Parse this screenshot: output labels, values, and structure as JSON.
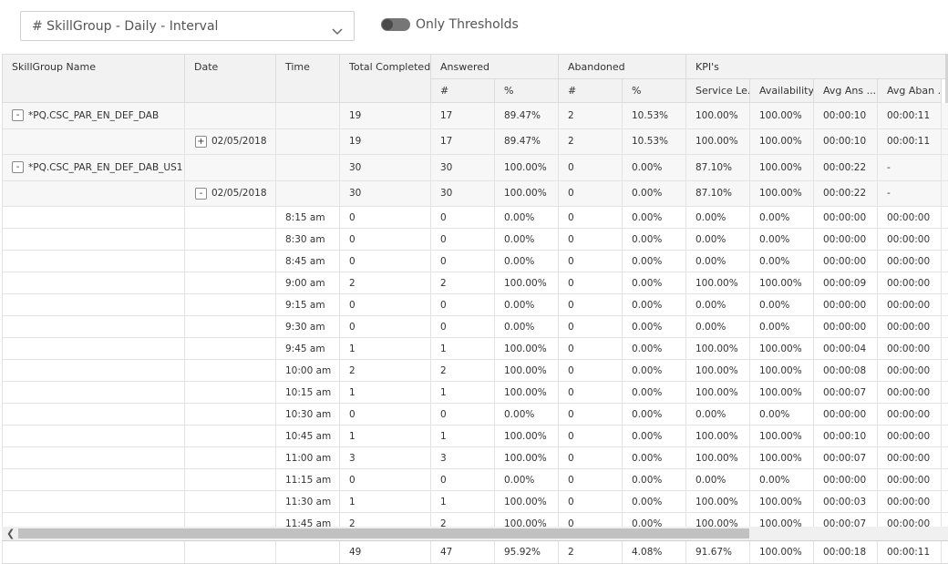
{
  "report_selector": {
    "value": "# SkillGroup - Daily - Interval",
    "icon": "chevron-down-icon"
  },
  "threshold_toggle": {
    "label": "Only Thresholds",
    "on": false
  },
  "table": {
    "headers": {
      "skillgroup": "SkillGroup Name",
      "date": "Date",
      "time": "Time",
      "total_completed": "Total Completed",
      "answered": "Answered",
      "abandoned": "Abandoned",
      "kpis": "KPI's",
      "answered_num": "#",
      "answered_pct": "%",
      "abandoned_num": "#",
      "abandoned_pct": "%",
      "service_level": "Service Le...",
      "availability": "Availability",
      "avg_ans": "Avg Ans ...",
      "avg_aban": "Avg Aban ..."
    },
    "rows": [
      {
        "type": "group",
        "toggle": "-",
        "name": "*PQ.CSC_PAR_EN_DEF_DAB",
        "date": "",
        "time": "",
        "total": "19",
        "ans": "17",
        "ans_pct": "89.47%",
        "aban": "2",
        "aban_pct": "10.53%",
        "sl": "100.00%",
        "avail": "100.00%",
        "avg_ans": "00:00:10",
        "avg_aban": "00:00:11"
      },
      {
        "type": "date",
        "toggle": "+",
        "name": "",
        "date": "02/05/2018",
        "time": "",
        "total": "19",
        "ans": "17",
        "ans_pct": "89.47%",
        "aban": "2",
        "aban_pct": "10.53%",
        "sl": "100.00%",
        "avail": "100.00%",
        "avg_ans": "00:00:10",
        "avg_aban": "00:00:11"
      },
      {
        "type": "group",
        "toggle": "-",
        "name": "*PQ.CSC_PAR_EN_DEF_DAB_US1",
        "date": "",
        "time": "",
        "total": "30",
        "ans": "30",
        "ans_pct": "100.00%",
        "aban": "0",
        "aban_pct": "0.00%",
        "sl": "87.10%",
        "avail": "100.00%",
        "avg_ans": "00:00:22",
        "avg_aban": "-"
      },
      {
        "type": "date",
        "toggle": "-",
        "name": "",
        "date": "02/05/2018",
        "time": "",
        "total": "30",
        "ans": "30",
        "ans_pct": "100.00%",
        "aban": "0",
        "aban_pct": "0.00%",
        "sl": "87.10%",
        "avail": "100.00%",
        "avg_ans": "00:00:22",
        "avg_aban": "-"
      },
      {
        "type": "interval",
        "toggle": "",
        "name": "",
        "date": "",
        "time": "8:15 am",
        "total": "0",
        "ans": "0",
        "ans_pct": "0.00%",
        "aban": "0",
        "aban_pct": "0.00%",
        "sl": "0.00%",
        "avail": "0.00%",
        "avg_ans": "00:00:00",
        "avg_aban": "00:00:00"
      },
      {
        "type": "interval",
        "toggle": "",
        "name": "",
        "date": "",
        "time": "8:30 am",
        "total": "0",
        "ans": "0",
        "ans_pct": "0.00%",
        "aban": "0",
        "aban_pct": "0.00%",
        "sl": "0.00%",
        "avail": "0.00%",
        "avg_ans": "00:00:00",
        "avg_aban": "00:00:00"
      },
      {
        "type": "interval",
        "toggle": "",
        "name": "",
        "date": "",
        "time": "8:45 am",
        "total": "0",
        "ans": "0",
        "ans_pct": "0.00%",
        "aban": "0",
        "aban_pct": "0.00%",
        "sl": "0.00%",
        "avail": "0.00%",
        "avg_ans": "00:00:00",
        "avg_aban": "00:00:00"
      },
      {
        "type": "interval",
        "toggle": "",
        "name": "",
        "date": "",
        "time": "9:00 am",
        "total": "2",
        "ans": "2",
        "ans_pct": "100.00%",
        "aban": "0",
        "aban_pct": "0.00%",
        "sl": "100.00%",
        "avail": "100.00%",
        "avg_ans": "00:00:09",
        "avg_aban": "00:00:00"
      },
      {
        "type": "interval",
        "toggle": "",
        "name": "",
        "date": "",
        "time": "9:15 am",
        "total": "0",
        "ans": "0",
        "ans_pct": "0.00%",
        "aban": "0",
        "aban_pct": "0.00%",
        "sl": "0.00%",
        "avail": "0.00%",
        "avg_ans": "00:00:00",
        "avg_aban": "00:00:00"
      },
      {
        "type": "interval",
        "toggle": "",
        "name": "",
        "date": "",
        "time": "9:30 am",
        "total": "0",
        "ans": "0",
        "ans_pct": "0.00%",
        "aban": "0",
        "aban_pct": "0.00%",
        "sl": "0.00%",
        "avail": "0.00%",
        "avg_ans": "00:00:00",
        "avg_aban": "00:00:00"
      },
      {
        "type": "interval",
        "toggle": "",
        "name": "",
        "date": "",
        "time": "9:45 am",
        "total": "1",
        "ans": "1",
        "ans_pct": "100.00%",
        "aban": "0",
        "aban_pct": "0.00%",
        "sl": "100.00%",
        "avail": "100.00%",
        "avg_ans": "00:00:04",
        "avg_aban": "00:00:00"
      },
      {
        "type": "interval",
        "toggle": "",
        "name": "",
        "date": "",
        "time": "10:00 am",
        "total": "2",
        "ans": "2",
        "ans_pct": "100.00%",
        "aban": "0",
        "aban_pct": "0.00%",
        "sl": "100.00%",
        "avail": "100.00%",
        "avg_ans": "00:00:08",
        "avg_aban": "00:00:00"
      },
      {
        "type": "interval",
        "toggle": "",
        "name": "",
        "date": "",
        "time": "10:15 am",
        "total": "1",
        "ans": "1",
        "ans_pct": "100.00%",
        "aban": "0",
        "aban_pct": "0.00%",
        "sl": "100.00%",
        "avail": "100.00%",
        "avg_ans": "00:00:07",
        "avg_aban": "00:00:00"
      },
      {
        "type": "interval",
        "toggle": "",
        "name": "",
        "date": "",
        "time": "10:30 am",
        "total": "0",
        "ans": "0",
        "ans_pct": "0.00%",
        "aban": "0",
        "aban_pct": "0.00%",
        "sl": "0.00%",
        "avail": "0.00%",
        "avg_ans": "00:00:00",
        "avg_aban": "00:00:00"
      },
      {
        "type": "interval",
        "toggle": "",
        "name": "",
        "date": "",
        "time": "10:45 am",
        "total": "1",
        "ans": "1",
        "ans_pct": "100.00%",
        "aban": "0",
        "aban_pct": "0.00%",
        "sl": "100.00%",
        "avail": "100.00%",
        "avg_ans": "00:00:10",
        "avg_aban": "00:00:00"
      },
      {
        "type": "interval",
        "toggle": "",
        "name": "",
        "date": "",
        "time": "11:00 am",
        "total": "3",
        "ans": "3",
        "ans_pct": "100.00%",
        "aban": "0",
        "aban_pct": "0.00%",
        "sl": "100.00%",
        "avail": "100.00%",
        "avg_ans": "00:00:07",
        "avg_aban": "00:00:00"
      },
      {
        "type": "interval",
        "toggle": "",
        "name": "",
        "date": "",
        "time": "11:15 am",
        "total": "0",
        "ans": "0",
        "ans_pct": "0.00%",
        "aban": "0",
        "aban_pct": "0.00%",
        "sl": "0.00%",
        "avail": "0.00%",
        "avg_ans": "00:00:00",
        "avg_aban": "00:00:00"
      },
      {
        "type": "interval",
        "toggle": "",
        "name": "",
        "date": "",
        "time": "11:30 am",
        "total": "1",
        "ans": "1",
        "ans_pct": "100.00%",
        "aban": "0",
        "aban_pct": "0.00%",
        "sl": "100.00%",
        "avail": "100.00%",
        "avg_ans": "00:00:03",
        "avg_aban": "00:00:00"
      },
      {
        "type": "interval",
        "toggle": "",
        "name": "",
        "date": "",
        "time": "11:45 am",
        "total": "2",
        "ans": "2",
        "ans_pct": "100.00%",
        "aban": "0",
        "aban_pct": "0.00%",
        "sl": "100.00%",
        "avail": "100.00%",
        "avg_ans": "00:00:07",
        "avg_aban": "00:00:00"
      }
    ],
    "totals": {
      "total": "49",
      "ans": "47",
      "ans_pct": "95.92%",
      "aban": "2",
      "aban_pct": "4.08%",
      "sl": "91.67%",
      "avail": "100.00%",
      "avg_ans": "00:00:18",
      "avg_aban": "00:00:11"
    },
    "scroll_left_icon": "chevron-left-icon"
  }
}
